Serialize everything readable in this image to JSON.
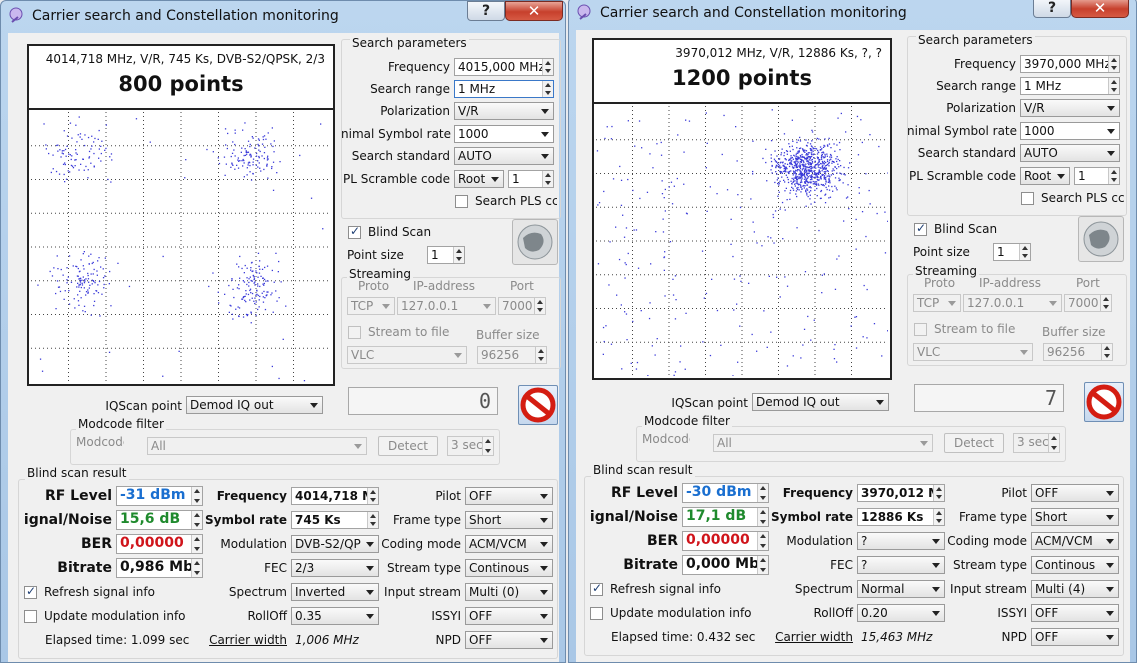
{
  "windows": [
    {
      "title": "Carrier search and Constellation monitoring",
      "plot": {
        "info": "4014,718 MHz, V/R, 745 Ks, DVB-S2/QPSK, 2/3",
        "points_label": "800 points",
        "clusters": [
          [
            0.163,
            0.146,
            90,
            0.055,
            0.05
          ],
          [
            0.728,
            0.158,
            120,
            0.05,
            0.045
          ],
          [
            0.168,
            0.628,
            120,
            0.055,
            0.05
          ],
          [
            0.737,
            0.653,
            140,
            0.045,
            0.055
          ]
        ],
        "noise": 25
      },
      "search": {
        "group_label": "Search parameters",
        "frequency_label": "Frequency",
        "frequency_value": "4015,000 MHz",
        "range_label": "Search range",
        "range_value": "1 MHz",
        "polarization_label": "Polarization",
        "polarization_value": "V/R",
        "symbol_rate_label": "nimal Symbol rate",
        "symbol_rate_value": "1000",
        "standard_label": "Search standard",
        "standard_value": "AUTO",
        "pl_label": "PL Scramble code",
        "pl_mode": "Root",
        "pl_value": "1",
        "search_pls_label": "Search PLS cc"
      },
      "blind_scan_label": "Blind Scan",
      "blind_scan_checked": true,
      "point_size_label": "Point size",
      "point_size_value": "1",
      "streaming": {
        "group_label": "Streaming",
        "proto_label": "Proto",
        "ip_label": "IP-address",
        "port_label": "Port",
        "proto_value": "TCP",
        "ip_value": "127.0.0.1",
        "port_value": "7000",
        "stream_file_label": "Stream to file",
        "buffer_label": "Buffer size",
        "player_value": "VLC",
        "buffer_value": "96256"
      },
      "status_value": "0",
      "iq": {
        "label": "IQScan point",
        "value": "Demod IQ out"
      },
      "modcode": {
        "group_label": "Modcode filter",
        "label": "Modcode",
        "value": "All",
        "detect_label": "Detect",
        "time_value": "3 sec"
      },
      "result": {
        "group_label": "Blind scan result",
        "rf_label": "RF Level",
        "rf_value": "-31 dBm",
        "rf_color": "#1a6fd0",
        "sn_label": "ignal/Noise",
        "sn_value": "15,6 dB",
        "sn_color": "#1f8a2d",
        "ber_label": "BER",
        "ber_value": "0,00000",
        "ber_color": "#d0141b",
        "bitrate_label": "Bitrate",
        "bitrate_value": "0,986 Mb",
        "frequency_label": "Frequency",
        "frequency_value": "4014,718 M",
        "symbol_rate_label": "Symbol rate",
        "symbol_rate_value": "745 Ks",
        "modulation_label": "Modulation",
        "modulation_value": "DVB-S2/QP",
        "fec_label": "FEC",
        "fec_value": "2/3",
        "spectrum_label": "Spectrum",
        "spectrum_value": "Inverted",
        "rolloff_label": "RollOff",
        "rolloff_value": "0.35",
        "carrier_width_label": "Carrier width",
        "carrier_width_value": "1,006 MHz",
        "pilot_label": "Pilot",
        "pilot_value": "OFF",
        "frame_label": "Frame type",
        "frame_value": "Short",
        "coding_label": "Coding mode",
        "coding_value": "ACM/VCM",
        "stream_type_label": "Stream type",
        "stream_type_value": "Continous",
        "input_stream_label": "Input stream",
        "input_stream_value": "Multi (0)",
        "issyi_label": "ISSYI",
        "issyi_value": "OFF",
        "npd_label": "NPD",
        "npd_value": "OFF",
        "refresh_label": "Refresh signal info",
        "refresh_checked": true,
        "update_label": "Update modulation info",
        "update_checked": false,
        "elapsed_label": "Elapsed time: 1.099 sec"
      }
    },
    {
      "title": "Carrier search and Constellation monitoring",
      "plot": {
        "info": "3970,012 MHz, V/R, 12886 Ks, ?, ?",
        "points_label": "1200 points",
        "clusters": [
          [
            0.72,
            0.23,
            700,
            0.055,
            0.045
          ]
        ],
        "noise": 240
      },
      "search": {
        "group_label": "Search parameters",
        "frequency_label": "Frequency",
        "frequency_value": "3970,000 MHz",
        "range_label": "Search range",
        "range_value": "1 MHz",
        "polarization_label": "Polarization",
        "polarization_value": "V/R",
        "symbol_rate_label": "nimal Symbol rate",
        "symbol_rate_value": "1000",
        "standard_label": "Search standard",
        "standard_value": "AUTO",
        "pl_label": "PL Scramble code",
        "pl_mode": "Root",
        "pl_value": "1",
        "search_pls_label": "Search PLS cc"
      },
      "blind_scan_label": "Blind Scan",
      "blind_scan_checked": true,
      "point_size_label": "Point size",
      "point_size_value": "1",
      "streaming": {
        "group_label": "Streaming",
        "proto_label": "Proto",
        "ip_label": "IP-address",
        "port_label": "Port",
        "proto_value": "TCP",
        "ip_value": "127.0.0.1",
        "port_value": "7000",
        "stream_file_label": "Stream to file",
        "buffer_label": "Buffer size",
        "player_value": "VLC",
        "buffer_value": "96256"
      },
      "status_value": "7",
      "iq": {
        "label": "IQScan point",
        "value": "Demod IQ out"
      },
      "modcode": {
        "group_label": "Modcode filter",
        "label": "Modcode",
        "value": "All",
        "detect_label": "Detect",
        "time_value": "3 sec"
      },
      "result": {
        "group_label": "Blind scan result",
        "rf_label": "RF Level",
        "rf_value": "-30 dBm",
        "rf_color": "#1a6fd0",
        "sn_label": "ignal/Noise",
        "sn_value": "17,1 dB",
        "sn_color": "#1f8a2d",
        "ber_label": "BER",
        "ber_value": "0,00000",
        "ber_color": "#d0141b",
        "bitrate_label": "Bitrate",
        "bitrate_value": "0,000 Mb",
        "frequency_label": "Frequency",
        "frequency_value": "3970,012 M",
        "symbol_rate_label": "Symbol rate",
        "symbol_rate_value": "12886 Ks",
        "modulation_label": "Modulation",
        "modulation_value": "?",
        "fec_label": "FEC",
        "fec_value": "?",
        "spectrum_label": "Spectrum",
        "spectrum_value": "Normal",
        "rolloff_label": "RollOff",
        "rolloff_value": "0.20",
        "carrier_width_label": "Carrier width",
        "carrier_width_value": "15,463 MHz",
        "pilot_label": "Pilot",
        "pilot_value": "OFF",
        "frame_label": "Frame type",
        "frame_value": "Short",
        "coding_label": "Coding mode",
        "coding_value": "ACM/VCM",
        "stream_type_label": "Stream type",
        "stream_type_value": "Continous",
        "input_stream_label": "Input stream",
        "input_stream_value": "Multi (4)",
        "issyi_label": "ISSYI",
        "issyi_value": "OFF",
        "npd_label": "NPD",
        "npd_value": "OFF",
        "refresh_label": "Refresh signal info",
        "refresh_checked": true,
        "update_label": "Update modulation info",
        "update_checked": false,
        "elapsed_label": "Elapsed time: 0.432 sec"
      }
    }
  ],
  "colors": {
    "constellation_point": "#3b3bd9",
    "grid": "#444444"
  },
  "icons": {
    "help": "?",
    "close": "✕",
    "check": "✓"
  }
}
